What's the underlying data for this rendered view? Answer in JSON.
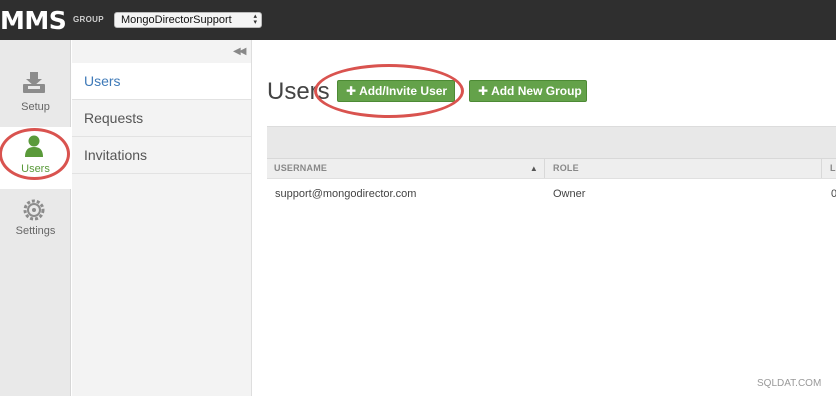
{
  "header": {
    "logo": "MMS",
    "group_label": "GROUP",
    "group_select_value": "MongoDirectorSupport",
    "group_select_arrow": "▲▼"
  },
  "rail": {
    "items": [
      {
        "label": "Setup",
        "icon": "setup-tray-icon"
      },
      {
        "label": "Users",
        "icon": "user-icon"
      },
      {
        "label": "Settings",
        "icon": "gear-icon"
      }
    ]
  },
  "subnav": {
    "collapse_glyph": "◀◀",
    "items": [
      {
        "label": "Users"
      },
      {
        "label": "Requests"
      },
      {
        "label": "Invitations"
      }
    ]
  },
  "main": {
    "title": "Users",
    "buttons": {
      "add_invite_user": "Add/Invite User",
      "add_new_group": "Add New Group",
      "plus": "✚"
    },
    "table": {
      "columns": [
        "USERNAME",
        "ROLE",
        "L"
      ],
      "sort_indicator": "▲",
      "rows": [
        {
          "username": "support@mongodirector.com",
          "role": "Owner",
          "last": "0"
        }
      ]
    }
  },
  "watermark": "SQLDAT.COM",
  "colors": {
    "accent_green": "#64a24a",
    "highlight_red": "#d9534f",
    "link_blue": "#3f7ab8",
    "topbar": "#2f2f2f"
  }
}
